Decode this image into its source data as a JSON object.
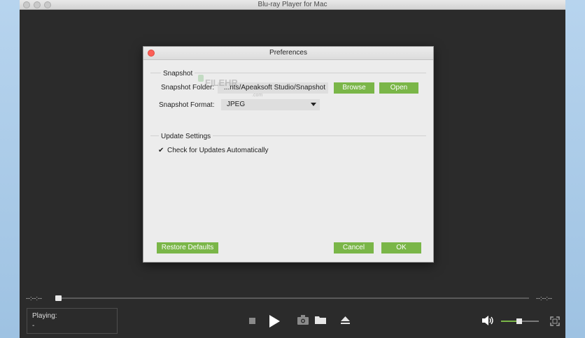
{
  "app": {
    "title": "Blu-ray Player for Mac"
  },
  "dialog": {
    "title": "Preferences",
    "snapshot": {
      "section": "Snapshot",
      "folder_label": "Snapshot Folder:",
      "folder_value": "...nts/Apeaksoft Studio/Snapshot",
      "browse": "Browse",
      "open": "Open",
      "format_label": "Snapshot Format:",
      "format_value": "JPEG"
    },
    "update": {
      "section": "Update Settings",
      "check_mark": "✔",
      "check_label": "Check for Updates Automatically"
    },
    "restore": "Restore Defaults",
    "cancel": "Cancel",
    "ok": "OK"
  },
  "watermark": {
    "text": "FILEHR",
    "sub": ".com"
  },
  "player": {
    "time_left": "--:--:--",
    "time_right": "--:--:--",
    "progress": 0,
    "playing_label": "Playing:",
    "playing_value": "-",
    "volume": 0.5
  },
  "colors": {
    "accent": "#7ab648",
    "close": "#fc5f57",
    "background": "#2b2b2b"
  }
}
